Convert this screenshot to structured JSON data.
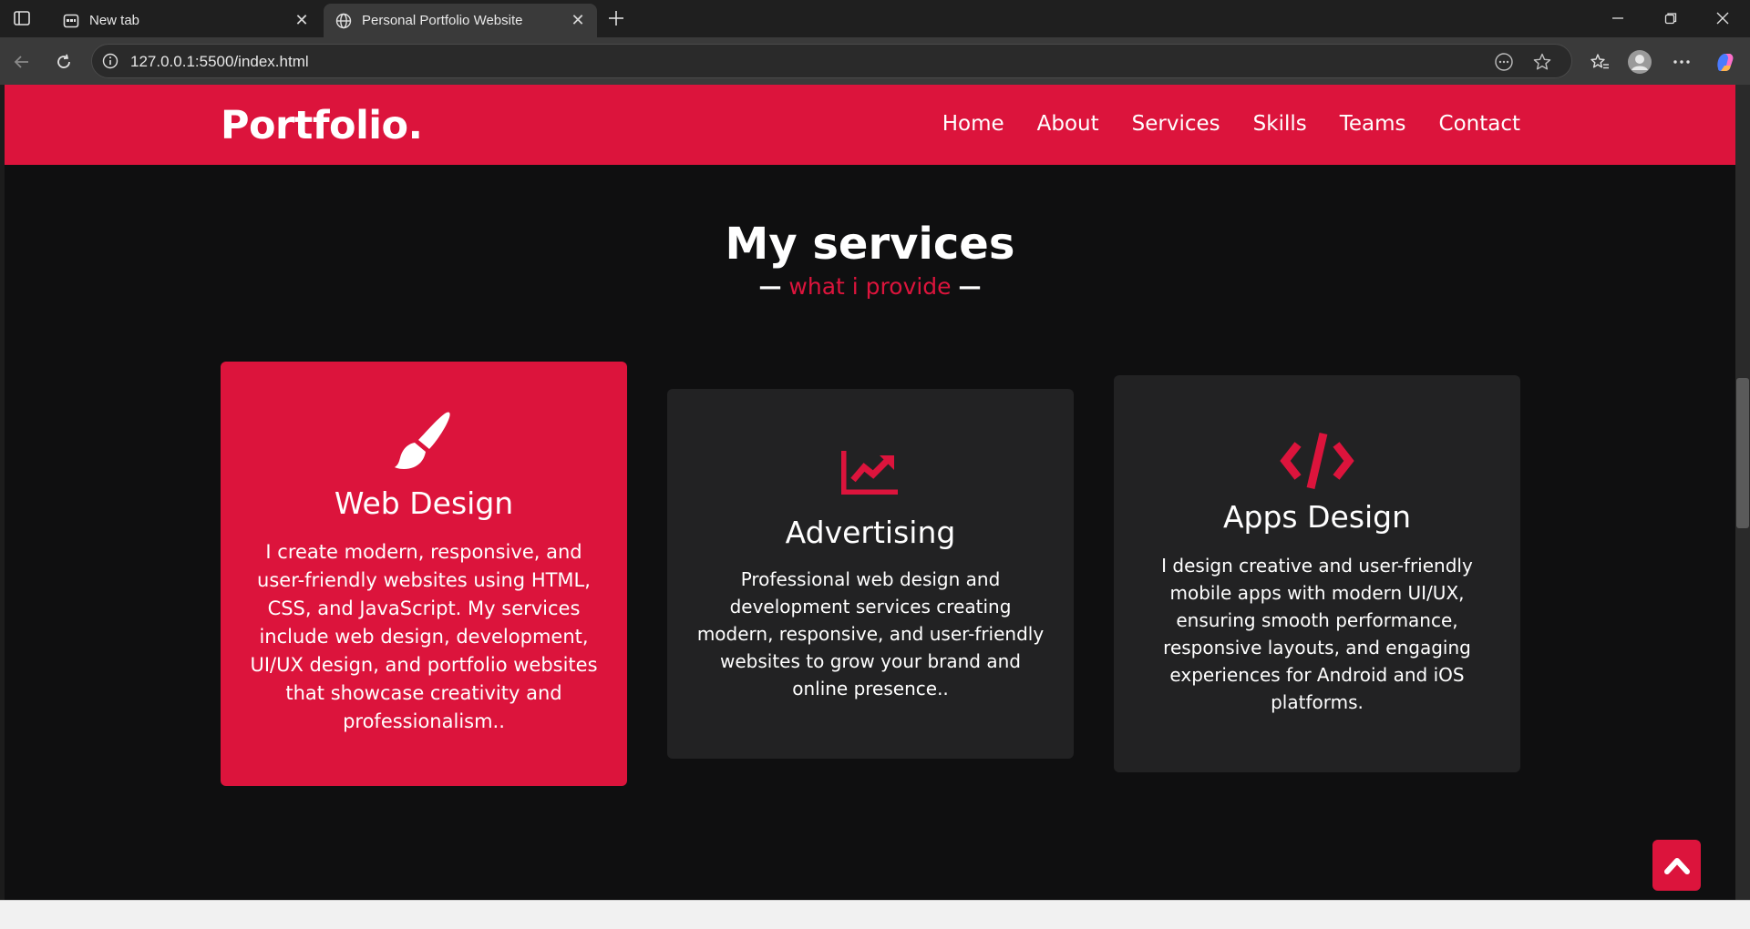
{
  "browser": {
    "tabs": [
      {
        "title": "New tab",
        "icon": "newtab-icon",
        "active": false
      },
      {
        "title": "Personal Portfolio Website",
        "icon": "globe-icon",
        "active": true
      }
    ],
    "url": "127.0.0.1:5500/index.html"
  },
  "site": {
    "logo": "Portfolio.",
    "nav": [
      "Home",
      "About",
      "Services",
      "Skills",
      "Teams",
      "Contact"
    ],
    "accent_color": "#dc143c"
  },
  "services": {
    "title": "My services",
    "subtitle_dash_left": "—",
    "subtitle": "what i provide",
    "subtitle_dash_right": "—",
    "cards": [
      {
        "icon": "paintbrush-icon",
        "title": "Web Design",
        "text": "I create modern, responsive, and user-friendly websites using HTML, CSS, and JavaScript. My services include web design, development, UI/UX design, and portfolio websites that showcase creativity and professionalism.."
      },
      {
        "icon": "chart-line-icon",
        "title": "Advertising",
        "text": "Professional web design and development services creating modern, responsive, and user-friendly websites to grow your brand and online presence.."
      },
      {
        "icon": "code-icon",
        "title": "Apps Design",
        "text": "I design creative and user-friendly mobile apps with modern UI/UX, ensuring smooth performance, responsive layouts, and engaging experiences for Android and iOS platforms."
      }
    ]
  }
}
